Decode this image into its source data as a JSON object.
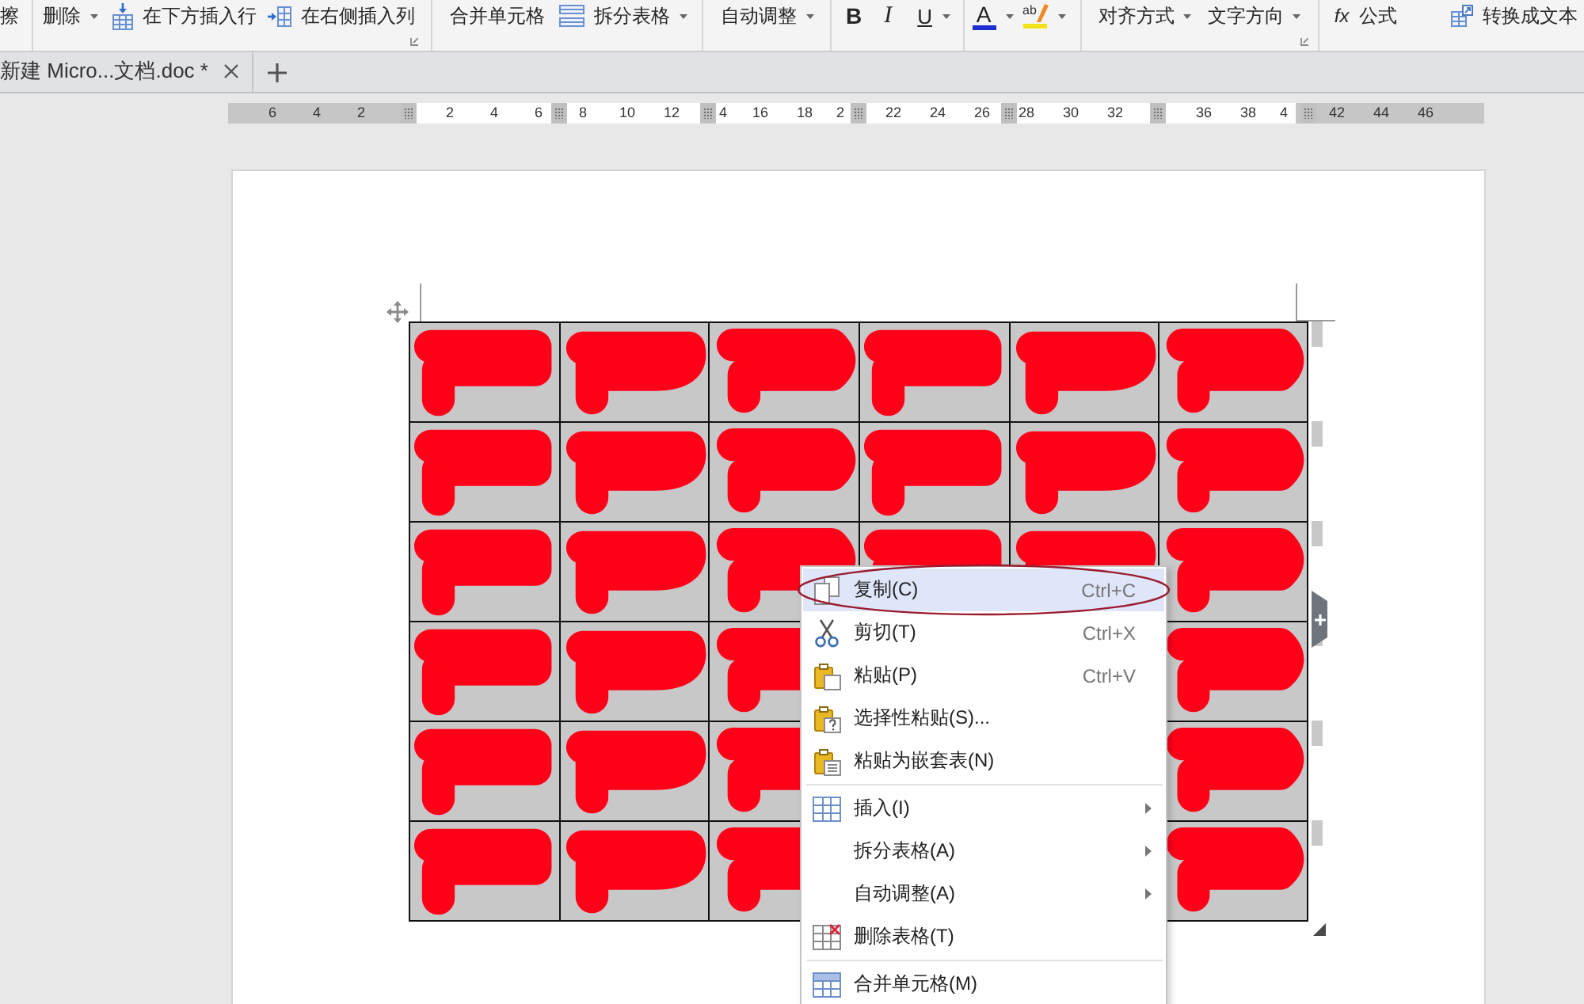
{
  "toolbar": {
    "eraser": "擦",
    "delete": "删除",
    "insert_row_below": "在下方插入行",
    "insert_column_right": "在右侧插入列",
    "merge_cells": "合并单元格",
    "split_table": "拆分表格",
    "autofit": "自动调整",
    "bold": "B",
    "italic": "I",
    "underline": "U",
    "font_color": "A",
    "highlight": "ab",
    "align": "对齐方式",
    "text_direction": "文字方向",
    "formula": "*fx* 公式",
    "convert_to_text": "转换成文本"
  },
  "tabs": [
    {
      "label": "新建 Micro...文档.doc *"
    }
  ],
  "ruler": {
    "marks": [
      {
        "kind": "number",
        "label": "6"
      },
      {
        "kind": "number",
        "label": "4"
      },
      {
        "kind": "number",
        "label": "2"
      },
      {
        "kind": "gap"
      },
      {
        "kind": "number",
        "label": "2"
      },
      {
        "kind": "number",
        "label": "4"
      },
      {
        "kind": "number",
        "label": "6"
      },
      {
        "kind": "number",
        "label": "8"
      },
      {
        "kind": "number",
        "label": "10"
      },
      {
        "kind": "number",
        "label": "12"
      },
      {
        "kind": "tail",
        "label": "4"
      },
      {
        "kind": "number",
        "label": "16"
      },
      {
        "kind": "number",
        "label": "18"
      },
      {
        "kind": "head",
        "label": "2"
      },
      {
        "kind": "number",
        "label": "22"
      },
      {
        "kind": "number",
        "label": "24"
      },
      {
        "kind": "number",
        "label": "26"
      },
      {
        "kind": "number",
        "label": "28"
      },
      {
        "kind": "number",
        "label": "30"
      },
      {
        "kind": "number",
        "label": "32"
      },
      {
        "kind": "gap"
      },
      {
        "kind": "number",
        "label": "36"
      },
      {
        "kind": "number",
        "label": "38"
      },
      {
        "kind": "head",
        "label": "4"
      },
      {
        "kind": "number",
        "label": "42"
      },
      {
        "kind": "number",
        "label": "44"
      },
      {
        "kind": "number",
        "label": "46"
      }
    ]
  },
  "table": {
    "selected": true,
    "rows": [
      {
        "cells": [
          {
            "kind": "scribbled"
          },
          {
            "kind": "scribbled"
          },
          {
            "kind": "scribbled"
          },
          {
            "kind": "scribbled"
          },
          {
            "kind": "scribbled"
          },
          {
            "kind": "scribbled"
          }
        ]
      },
      {
        "cells": [
          {
            "kind": "scribbled"
          },
          {
            "kind": "scribbled"
          },
          {
            "kind": "scribbled"
          },
          {
            "kind": "scribbled"
          },
          {
            "kind": "scribbled"
          },
          {
            "kind": "scribbled"
          }
        ]
      },
      {
        "cells": [
          {
            "kind": "scribbled"
          },
          {
            "kind": "scribbled"
          },
          {
            "kind": "scribbled"
          },
          {
            "kind": "scribbled"
          },
          {
            "kind": "scribbled"
          },
          {
            "kind": "scribbled"
          }
        ]
      },
      {
        "cells": [
          {
            "kind": "scribbled"
          },
          {
            "kind": "scribbled"
          },
          {
            "kind": "scribbled"
          },
          {
            "kind": "covered"
          },
          {
            "kind": "covered"
          },
          {
            "kind": "scribbled"
          }
        ]
      },
      {
        "cells": [
          {
            "kind": "scribbled"
          },
          {
            "kind": "scribbled"
          },
          {
            "kind": "scribbled"
          },
          {
            "kind": "covered"
          },
          {
            "kind": "covered"
          },
          {
            "kind": "scribbled"
          }
        ]
      },
      {
        "cells": [
          {
            "kind": "scribbled"
          },
          {
            "kind": "scribbled"
          },
          {
            "kind": "scribbled"
          },
          {
            "kind": "covered"
          },
          {
            "kind": "covered"
          },
          {
            "kind": "scribbled"
          }
        ]
      }
    ]
  },
  "context_menu": {
    "items": [
      {
        "kind": "item",
        "label": "复制(C)",
        "shortcut": "Ctrl+C",
        "submenu": false,
        "selected": true,
        "circled": true
      },
      {
        "kind": "item",
        "label": "剪切(T)",
        "shortcut": "Ctrl+X",
        "submenu": false,
        "selected": false,
        "circled": false
      },
      {
        "kind": "item",
        "label": "粘贴(P)",
        "shortcut": "Ctrl+V",
        "submenu": false,
        "selected": false,
        "circled": false
      },
      {
        "kind": "item",
        "label": "选择性粘贴(S)...",
        "submenu": false,
        "selected": false,
        "circled": false
      },
      {
        "kind": "item",
        "label": "粘贴为嵌套表(N)",
        "submenu": false,
        "selected": false,
        "circled": false
      },
      {
        "kind": "separator"
      },
      {
        "kind": "item",
        "label": "插入(I)",
        "submenu": true,
        "selected": false,
        "circled": false
      },
      {
        "kind": "item",
        "label": "拆分表格(A)",
        "submenu": true,
        "selected": false,
        "circled": false
      },
      {
        "kind": "item",
        "label": "自动调整(A)",
        "submenu": true,
        "selected": false,
        "circled": false
      },
      {
        "kind": "item",
        "label": "删除表格(T)",
        "submenu": false,
        "selected": false,
        "circled": false
      },
      {
        "kind": "separator"
      },
      {
        "kind": "item",
        "label": "合并单元格(M)",
        "submenu": false,
        "selected": false,
        "circled": false
      }
    ]
  }
}
